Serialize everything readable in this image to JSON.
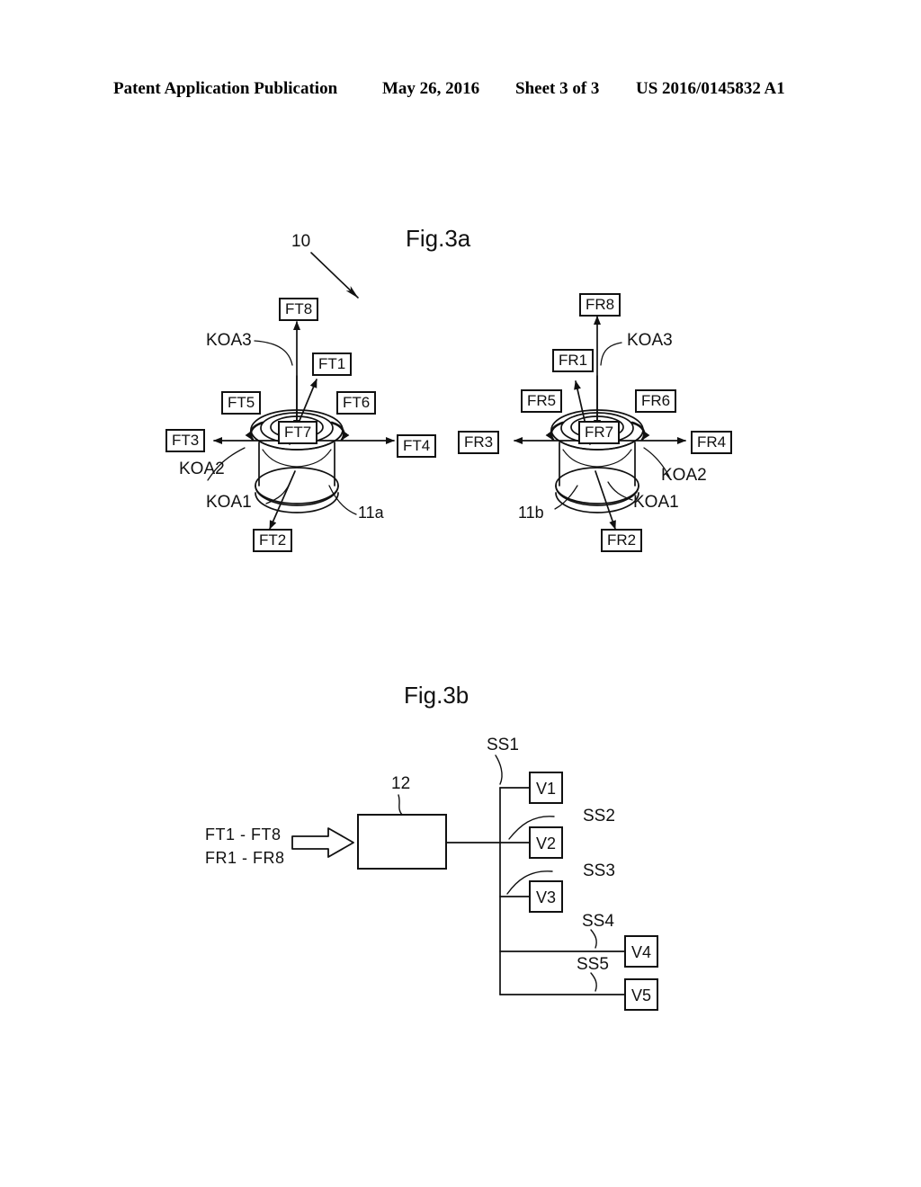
{
  "header": {
    "publication": "Patent Application Publication",
    "date": "May 26, 2016",
    "sheet": "Sheet 3 of 3",
    "number": "US 2016/0145832 A1"
  },
  "fig3a": {
    "title": "Fig.3a",
    "assembly_ref": "10",
    "left_sensor": {
      "body_ref": "11a",
      "tags": [
        "FT1",
        "FT2",
        "FT3",
        "FT4",
        "FT5",
        "FT6",
        "FT7",
        "FT8"
      ],
      "axes": [
        "KOA1",
        "KOA2",
        "KOA3"
      ],
      "tag_ft1": "FT1",
      "tag_ft2": "FT2",
      "tag_ft3": "FT3",
      "tag_ft4": "FT4",
      "tag_ft5": "FT5",
      "tag_ft6": "FT6",
      "tag_ft7": "FT7",
      "tag_ft8": "FT8",
      "koa1": "KOA1",
      "koa2": "KOA2",
      "koa3": "KOA3"
    },
    "right_sensor": {
      "body_ref": "11b",
      "tags": [
        "FR1",
        "FR2",
        "FR3",
        "FR4",
        "FR5",
        "FR6",
        "FR7",
        "FR8"
      ],
      "axes": [
        "KOA1",
        "KOA2",
        "KOA3"
      ],
      "tag_fr1": "FR1",
      "tag_fr2": "FR2",
      "tag_fr3": "FR3",
      "tag_fr4": "FR4",
      "tag_fr5": "FR5",
      "tag_fr6": "FR6",
      "tag_fr7": "FR7",
      "tag_fr8": "FR8",
      "koa1": "KOA1",
      "koa2": "KOA2",
      "koa3": "KOA3"
    }
  },
  "fig3b": {
    "title": "Fig.3b",
    "input_line1": "FT1 - FT8",
    "input_line2": "FR1 - FR8",
    "unit_ref": "12",
    "signals": [
      "SS1",
      "SS2",
      "SS3",
      "SS4",
      "SS5"
    ],
    "signal_ss1": "SS1",
    "signal_ss2": "SS2",
    "signal_ss3": "SS3",
    "signal_ss4": "SS4",
    "signal_ss5": "SS5",
    "consumers": [
      "V1",
      "V2",
      "V3",
      "V4",
      "V5"
    ],
    "consumer_v1": "V1",
    "consumer_v2": "V2",
    "consumer_v3": "V3",
    "consumer_v4": "V4",
    "consumer_v5": "V5"
  },
  "colors": {
    "ink": "#111111",
    "paper": "#ffffff"
  }
}
